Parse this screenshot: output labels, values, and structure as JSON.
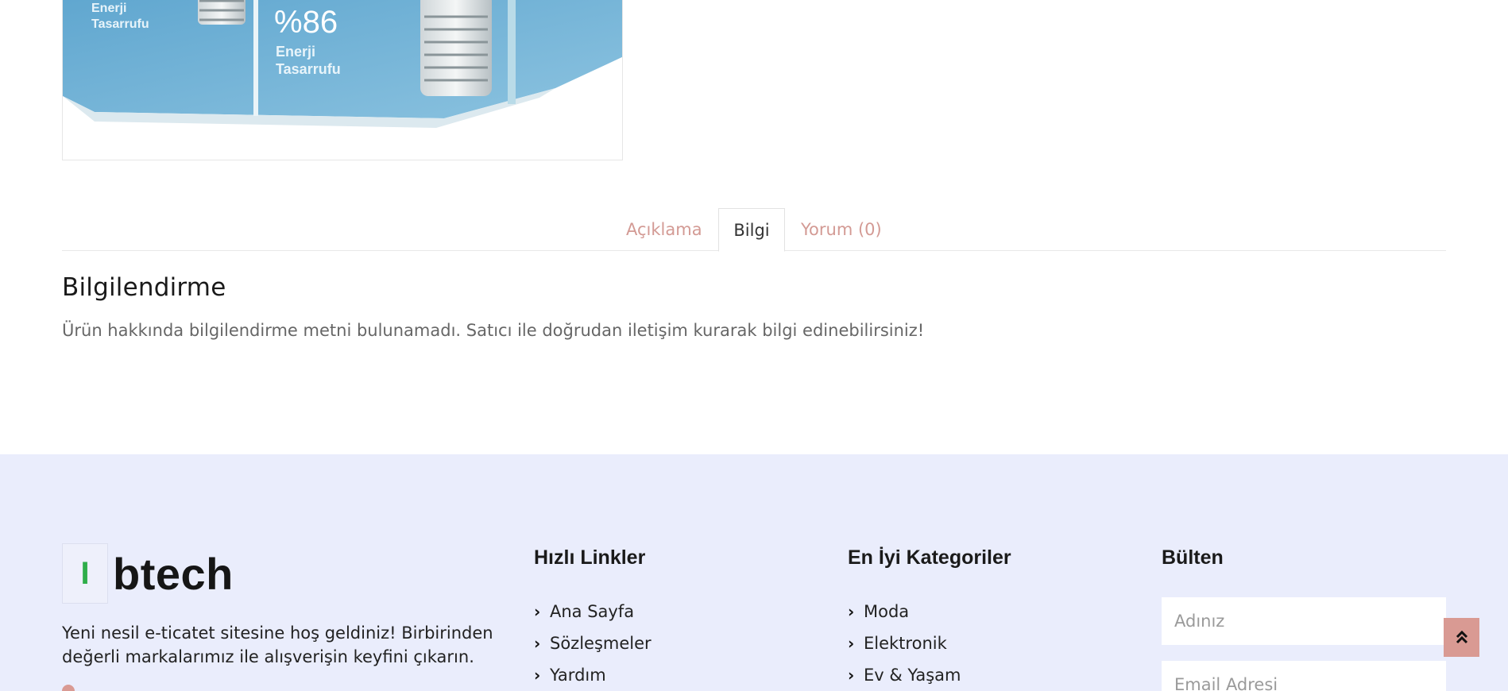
{
  "product_image": {
    "box_text_percent": "%86",
    "box_text_line1": "Enerji",
    "box_text_line2": "Tasarrufu",
    "box_text_left1": "Enerji",
    "box_text_left2": "Tasarrufu"
  },
  "tabs": [
    {
      "label": "Açıklama",
      "active": false
    },
    {
      "label": "Bilgi",
      "active": true
    },
    {
      "label": "Yorum (0)",
      "active": false
    }
  ],
  "info_section": {
    "heading": "Bilgilendirme",
    "text": "Ürün hakkında bilgilendirme metni bulunamadı. Satıcı ile doğrudan iletişim kurarak bilgi edinebilirsiniz!"
  },
  "footer": {
    "logo_mark": "I",
    "logo_text": "btech",
    "about_text": "Yeni nesil e-ticatet sitesine hoş geldiniz! Birbirinden değerli markalarımız ile alışverişin keyfini çıkarın.",
    "quick_links": {
      "title": "Hızlı Linkler",
      "items": [
        "Ana Sayfa",
        "Sözleşmeler",
        "Yardım"
      ]
    },
    "categories": {
      "title": "En İyi Kategoriler",
      "items": [
        "Moda",
        "Elektronik",
        "Ev & Yaşam"
      ]
    },
    "newsletter": {
      "title": "Bülten",
      "name_placeholder": "Adınız",
      "email_placeholder": "Email Adresi"
    }
  },
  "colors": {
    "accent": "#d99a93",
    "footer_bg": "#eaedfc",
    "logo_green": "#2fae4a"
  },
  "icons": {
    "chevron": "chevron-right-icon",
    "location": "location-pin-icon",
    "scroll_top": "double-chevron-up-icon"
  }
}
